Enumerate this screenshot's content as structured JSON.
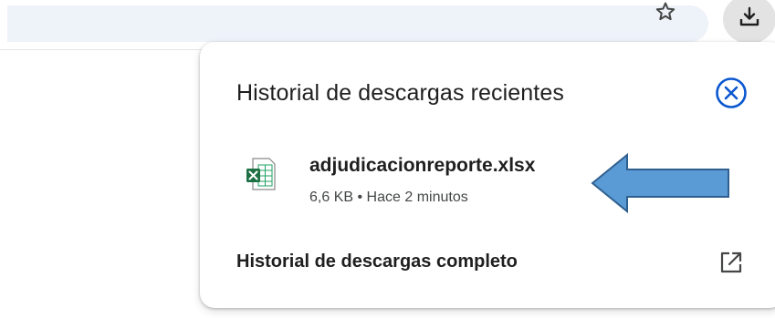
{
  "popup": {
    "title": "Historial de descargas recientes",
    "download_item": {
      "filename": "adjudicacionreporte.xlsx",
      "size": "6,6 KB",
      "separator": "•",
      "time": "Hace 2 minutos",
      "icon": "excel-file-icon"
    },
    "full_history_label": "Historial de descargas completo"
  },
  "icons": {
    "star": "bookmark-star-icon",
    "download": "download-icon",
    "close": "close-circle-icon",
    "open_external": "open-in-new-icon",
    "annotation": "annotation-arrow"
  },
  "colors": {
    "accent_blue": "#0b57d0",
    "arrow_fill": "#5b9bd5",
    "arrow_stroke": "#2f5f8f",
    "excel_green": "#1d7044",
    "omnibox_bg": "#eef2f9"
  }
}
